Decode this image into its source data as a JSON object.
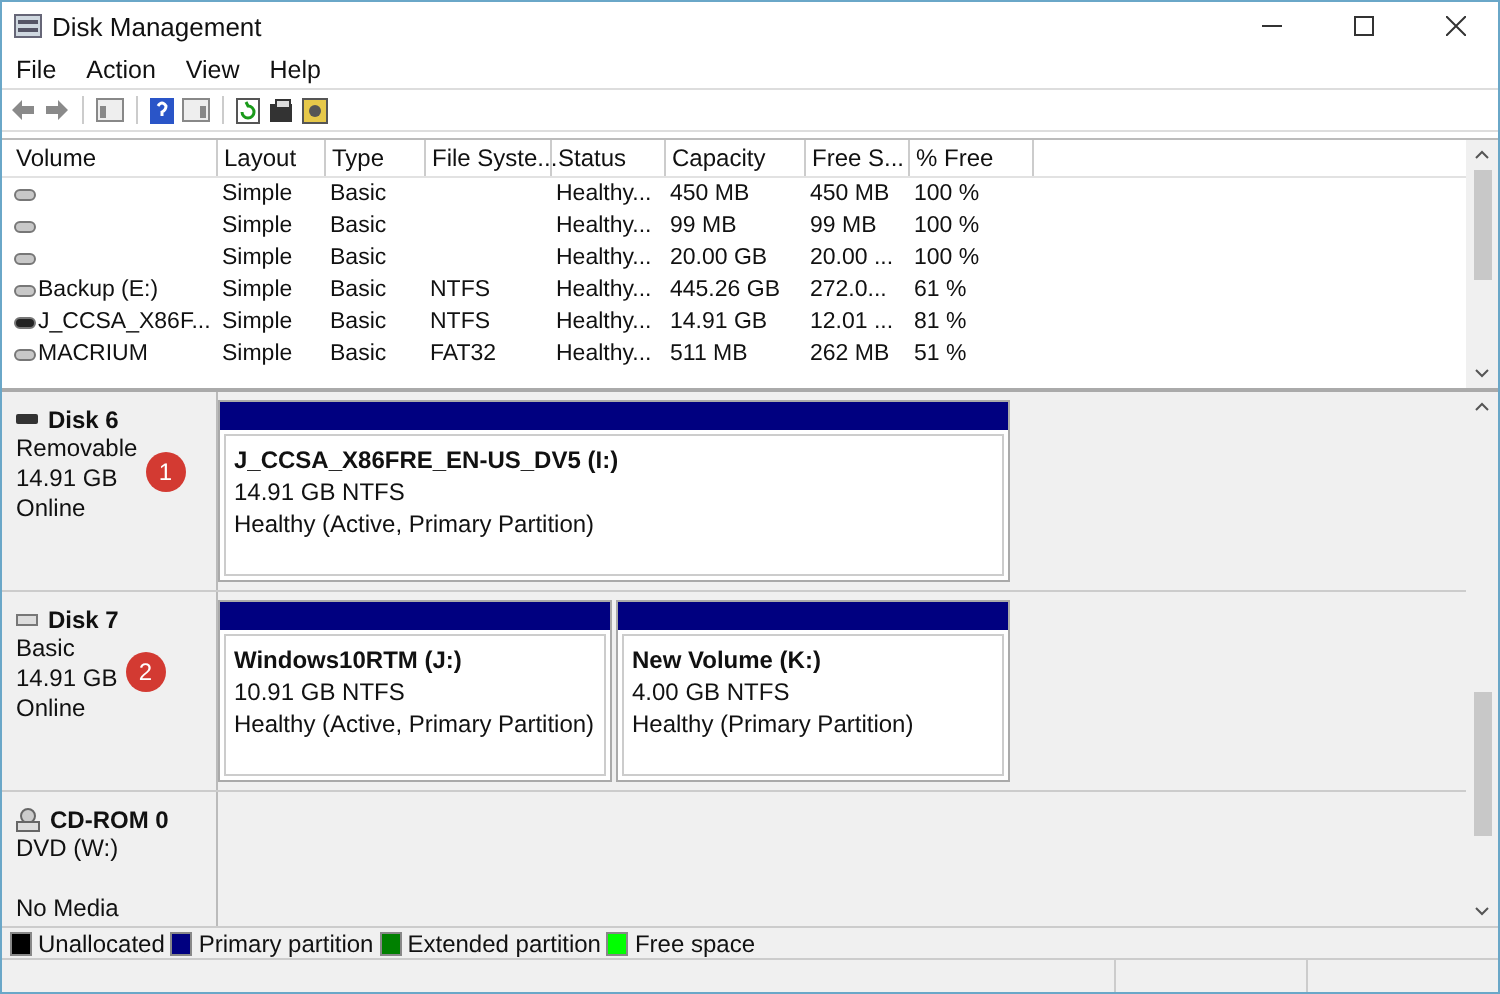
{
  "window": {
    "title": "Disk Management"
  },
  "menu": [
    "File",
    "Action",
    "View",
    "Help"
  ],
  "table": {
    "columns": [
      "Volume",
      "Layout",
      "Type",
      "File Syste...",
      "Status",
      "Capacity",
      "Free S...",
      "% Free"
    ],
    "rows": [
      {
        "kind": "hdd",
        "cells": [
          "",
          "Simple",
          "Basic",
          "",
          "Healthy...",
          "450 MB",
          "450 MB",
          "100 %"
        ]
      },
      {
        "kind": "hdd",
        "cells": [
          "",
          "Simple",
          "Basic",
          "",
          "Healthy...",
          "99 MB",
          "99 MB",
          "100 %"
        ]
      },
      {
        "kind": "hdd",
        "cells": [
          "",
          "Simple",
          "Basic",
          "",
          "Healthy...",
          "20.00 GB",
          "20.00 ...",
          "100 %"
        ]
      },
      {
        "kind": "hdd",
        "cells": [
          "Backup (E:)",
          "Simple",
          "Basic",
          "NTFS",
          "Healthy...",
          "445.26 GB",
          "272.0...",
          "61 %"
        ]
      },
      {
        "kind": "removable",
        "cells": [
          "J_CCSA_X86F...",
          "Simple",
          "Basic",
          "NTFS",
          "Healthy...",
          "14.91 GB",
          "12.01 ...",
          "81 %"
        ]
      },
      {
        "kind": "hdd",
        "cells": [
          "MACRIUM",
          "Simple",
          "Basic",
          "FAT32",
          "Healthy...",
          "511 MB",
          "262 MB",
          "51 %"
        ]
      }
    ]
  },
  "disks": [
    {
      "kind": "removable",
      "name": "Disk 6",
      "lines": [
        "Removable",
        "14.91 GB",
        "Online"
      ],
      "badge": "1",
      "partitions": [
        {
          "title": "J_CCSA_X86FRE_EN-US_DV5  (I:)",
          "lines": [
            "14.91 GB NTFS",
            "Healthy (Active, Primary Partition)"
          ]
        }
      ]
    },
    {
      "kind": "hdd",
      "name": "Disk 7",
      "lines": [
        "Basic",
        "14.91 GB",
        "Online"
      ],
      "badge": "2",
      "partitions": [
        {
          "title": "Windows10RTM  (J:)",
          "lines": [
            "10.91 GB NTFS",
            "Healthy (Active, Primary Partition)"
          ]
        },
        {
          "title": "New Volume  (K:)",
          "lines": [
            "4.00 GB NTFS",
            "Healthy (Primary Partition)"
          ]
        }
      ]
    },
    {
      "kind": "cdrom",
      "name": "CD-ROM 0",
      "lines": [
        "DVD (W:)",
        "No Media"
      ]
    }
  ],
  "legend": [
    {
      "label": "Unallocated",
      "color": "#000000"
    },
    {
      "label": "Primary partition",
      "color": "#000080"
    },
    {
      "label": "Extended partition",
      "color": "#008000"
    },
    {
      "label": "Free space",
      "color": "#00ff00"
    }
  ]
}
